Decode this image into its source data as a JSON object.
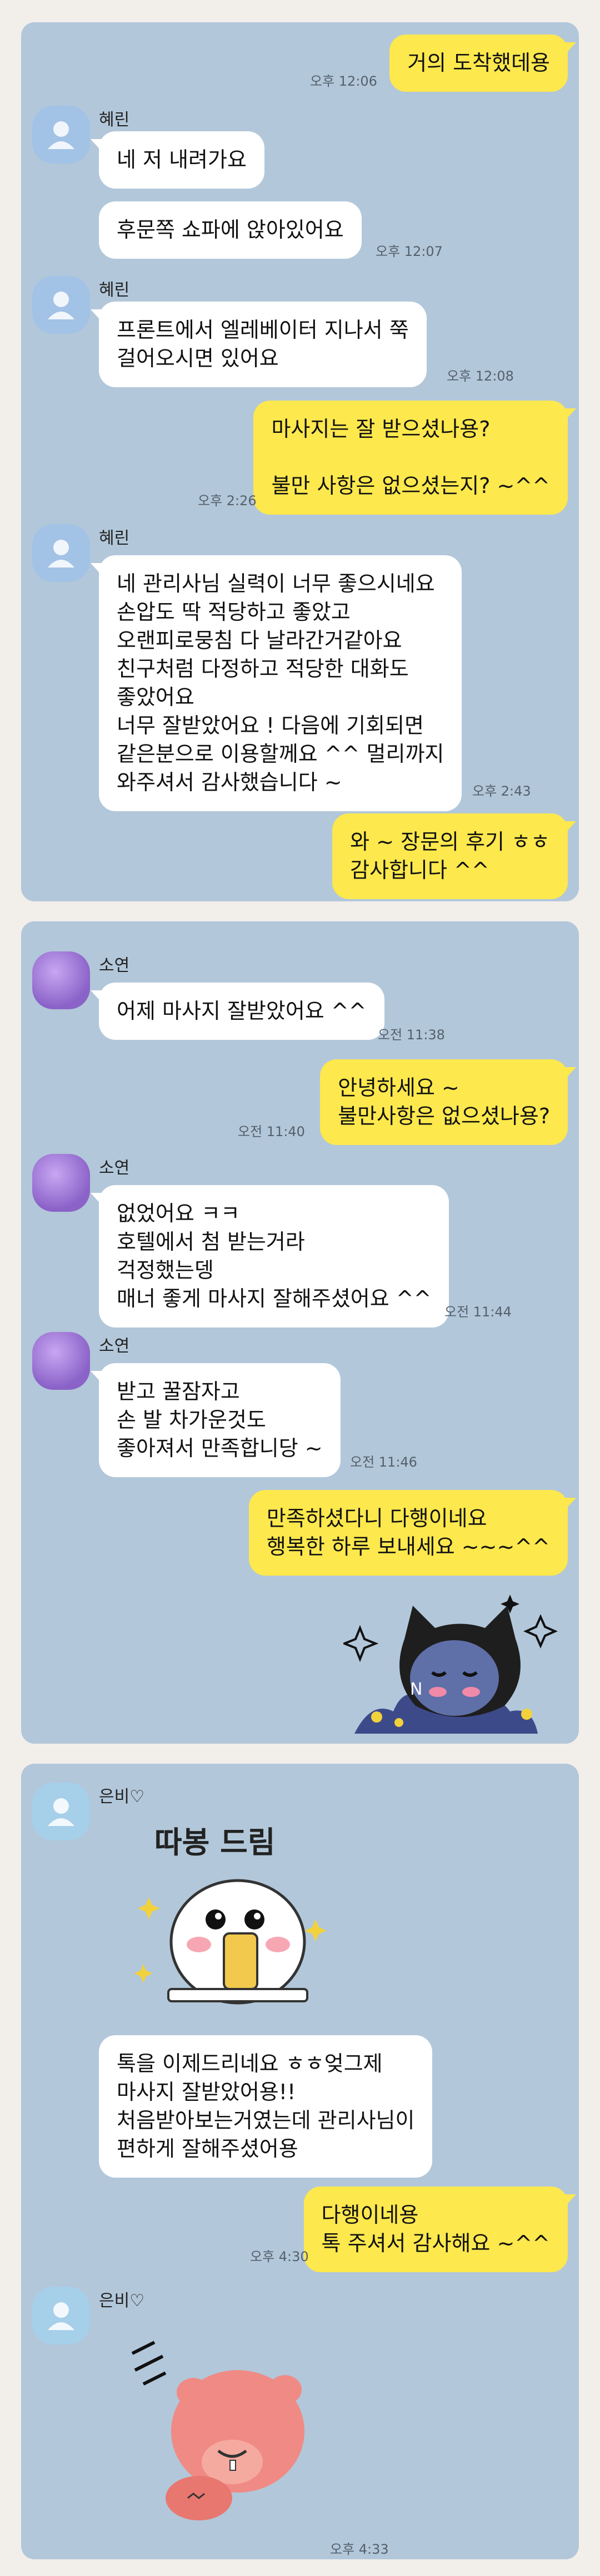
{
  "chat1": {
    "messages": [
      {
        "text": "거의 도착했데용",
        "time": "오후 12:06"
      },
      {
        "sender": "혜린",
        "text": "네 저 내려가요"
      },
      {
        "text": "후문쪽 쇼파에 앉아있어요",
        "time": "오후 12:07"
      },
      {
        "sender": "혜린",
        "text": "프론트에서 엘레베이터 지나서 쭉\n걸어오시면 있어요",
        "time": "오후 12:08"
      },
      {
        "text": "마사지는 잘 받으셨나용?\n\n불만 사항은 없으셨는지? ~^^",
        "time": "오후 2:26"
      },
      {
        "sender": "혜린",
        "text": "네 관리사님 실력이 너무 좋으시네요\n손압도 딱 적당하고 좋았고\n오랜피로뭉침 다 날라간거같아요\n친구처럼 다정하고 적당한 대화도\n좋았어요\n너무 잘받았어요 ! 다음에 기회되면\n같은분으로 이용할께요 ^^ 멀리까지\n와주셔서 감사했습니다 ~",
        "time": "오후 2:43"
      },
      {
        "text": "와 ~ 장문의 후기 ㅎㅎ\n감사합니다 ^^"
      }
    ]
  },
  "chat2": {
    "messages": [
      {
        "sender": "소연",
        "text": "어제 마사지 잘받았어요 ^^",
        "time": "오전 11:38"
      },
      {
        "text": "안녕하세요 ~\n불만사항은 없으셨나용?",
        "time": "오전 11:40"
      },
      {
        "sender": "소연",
        "text": "없었어요 ㅋㅋ\n호텔에서 첨 받는거라\n걱정했는뎅\n매너 좋게 마사지 잘해주셨어요 ^^",
        "time": "오전 11:44"
      },
      {
        "sender": "소연",
        "text": "받고 꿀잠자고\n손 발 차가운것도\n좋아져서 만족합니당 ~",
        "time": "오전 11:46"
      },
      {
        "text": "만족하셨다니 다행이네요\n행복한 하루 보내세요 ~~~^^"
      }
    ],
    "sticker": "ryan-cat-sticker"
  },
  "chat3": {
    "sender": "은비♡",
    "sticker1_text": "따봉 드림",
    "messages": [
      {
        "text": "톡을 이제드리네요 ㅎㅎ엊그제\n마사지 잘받았어용!!\n처음받아보는거였는데 관리사님이\n편하게 잘해주셨어용"
      },
      {
        "text": "다행이네용\n톡 주셔서 감사해요 ~^^",
        "time": "오후 4:30"
      }
    ],
    "sender2": "은비♡",
    "last_time": "오후 4:33"
  },
  "colors": {
    "panel": "#b2c7da",
    "mine": "#fde84d",
    "theirs": "#ffffff",
    "page": "#f2eeea"
  }
}
